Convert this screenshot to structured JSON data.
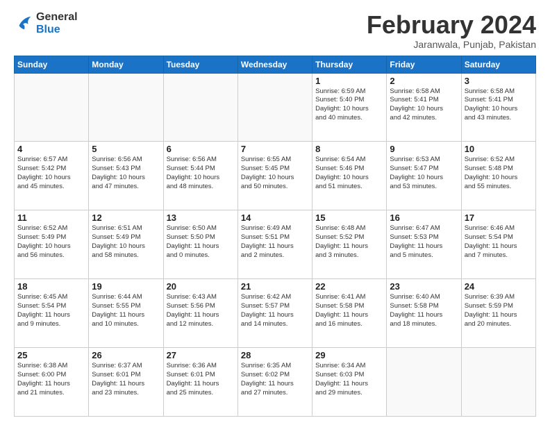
{
  "logo": {
    "line1": "General",
    "line2": "Blue"
  },
  "title": "February 2024",
  "location": "Jaranwala, Punjab, Pakistan",
  "days_of_week": [
    "Sunday",
    "Monday",
    "Tuesday",
    "Wednesday",
    "Thursday",
    "Friday",
    "Saturday"
  ],
  "weeks": [
    [
      {
        "day": "",
        "info": ""
      },
      {
        "day": "",
        "info": ""
      },
      {
        "day": "",
        "info": ""
      },
      {
        "day": "",
        "info": ""
      },
      {
        "day": "1",
        "info": "Sunrise: 6:59 AM\nSunset: 5:40 PM\nDaylight: 10 hours\nand 40 minutes."
      },
      {
        "day": "2",
        "info": "Sunrise: 6:58 AM\nSunset: 5:41 PM\nDaylight: 10 hours\nand 42 minutes."
      },
      {
        "day": "3",
        "info": "Sunrise: 6:58 AM\nSunset: 5:41 PM\nDaylight: 10 hours\nand 43 minutes."
      }
    ],
    [
      {
        "day": "4",
        "info": "Sunrise: 6:57 AM\nSunset: 5:42 PM\nDaylight: 10 hours\nand 45 minutes."
      },
      {
        "day": "5",
        "info": "Sunrise: 6:56 AM\nSunset: 5:43 PM\nDaylight: 10 hours\nand 47 minutes."
      },
      {
        "day": "6",
        "info": "Sunrise: 6:56 AM\nSunset: 5:44 PM\nDaylight: 10 hours\nand 48 minutes."
      },
      {
        "day": "7",
        "info": "Sunrise: 6:55 AM\nSunset: 5:45 PM\nDaylight: 10 hours\nand 50 minutes."
      },
      {
        "day": "8",
        "info": "Sunrise: 6:54 AM\nSunset: 5:46 PM\nDaylight: 10 hours\nand 51 minutes."
      },
      {
        "day": "9",
        "info": "Sunrise: 6:53 AM\nSunset: 5:47 PM\nDaylight: 10 hours\nand 53 minutes."
      },
      {
        "day": "10",
        "info": "Sunrise: 6:52 AM\nSunset: 5:48 PM\nDaylight: 10 hours\nand 55 minutes."
      }
    ],
    [
      {
        "day": "11",
        "info": "Sunrise: 6:52 AM\nSunset: 5:49 PM\nDaylight: 10 hours\nand 56 minutes."
      },
      {
        "day": "12",
        "info": "Sunrise: 6:51 AM\nSunset: 5:49 PM\nDaylight: 10 hours\nand 58 minutes."
      },
      {
        "day": "13",
        "info": "Sunrise: 6:50 AM\nSunset: 5:50 PM\nDaylight: 11 hours\nand 0 minutes."
      },
      {
        "day": "14",
        "info": "Sunrise: 6:49 AM\nSunset: 5:51 PM\nDaylight: 11 hours\nand 2 minutes."
      },
      {
        "day": "15",
        "info": "Sunrise: 6:48 AM\nSunset: 5:52 PM\nDaylight: 11 hours\nand 3 minutes."
      },
      {
        "day": "16",
        "info": "Sunrise: 6:47 AM\nSunset: 5:53 PM\nDaylight: 11 hours\nand 5 minutes."
      },
      {
        "day": "17",
        "info": "Sunrise: 6:46 AM\nSunset: 5:54 PM\nDaylight: 11 hours\nand 7 minutes."
      }
    ],
    [
      {
        "day": "18",
        "info": "Sunrise: 6:45 AM\nSunset: 5:54 PM\nDaylight: 11 hours\nand 9 minutes."
      },
      {
        "day": "19",
        "info": "Sunrise: 6:44 AM\nSunset: 5:55 PM\nDaylight: 11 hours\nand 10 minutes."
      },
      {
        "day": "20",
        "info": "Sunrise: 6:43 AM\nSunset: 5:56 PM\nDaylight: 11 hours\nand 12 minutes."
      },
      {
        "day": "21",
        "info": "Sunrise: 6:42 AM\nSunset: 5:57 PM\nDaylight: 11 hours\nand 14 minutes."
      },
      {
        "day": "22",
        "info": "Sunrise: 6:41 AM\nSunset: 5:58 PM\nDaylight: 11 hours\nand 16 minutes."
      },
      {
        "day": "23",
        "info": "Sunrise: 6:40 AM\nSunset: 5:58 PM\nDaylight: 11 hours\nand 18 minutes."
      },
      {
        "day": "24",
        "info": "Sunrise: 6:39 AM\nSunset: 5:59 PM\nDaylight: 11 hours\nand 20 minutes."
      }
    ],
    [
      {
        "day": "25",
        "info": "Sunrise: 6:38 AM\nSunset: 6:00 PM\nDaylight: 11 hours\nand 21 minutes."
      },
      {
        "day": "26",
        "info": "Sunrise: 6:37 AM\nSunset: 6:01 PM\nDaylight: 11 hours\nand 23 minutes."
      },
      {
        "day": "27",
        "info": "Sunrise: 6:36 AM\nSunset: 6:01 PM\nDaylight: 11 hours\nand 25 minutes."
      },
      {
        "day": "28",
        "info": "Sunrise: 6:35 AM\nSunset: 6:02 PM\nDaylight: 11 hours\nand 27 minutes."
      },
      {
        "day": "29",
        "info": "Sunrise: 6:34 AM\nSunset: 6:03 PM\nDaylight: 11 hours\nand 29 minutes."
      },
      {
        "day": "",
        "info": ""
      },
      {
        "day": "",
        "info": ""
      }
    ]
  ]
}
